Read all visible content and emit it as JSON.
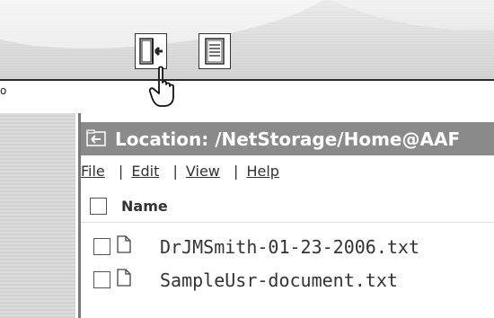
{
  "toolbar": {
    "buttons": [
      {
        "name": "exit-button",
        "icon": "exit-door-icon"
      },
      {
        "name": "document-button",
        "icon": "document-list-icon"
      }
    ],
    "cursor_icon": "hand-pointer-icon",
    "left_truncated_char": "o"
  },
  "location": {
    "icon": "folder-up-icon",
    "label": "Location: /NetStorage/Home@AAF"
  },
  "menu": {
    "items": [
      "File",
      "Edit",
      "View",
      "Help"
    ],
    "separator": "|"
  },
  "file_list": {
    "header": "Name",
    "rows": [
      {
        "name": "DrJMSmith-01-23-2006.txt",
        "icon": "text-file-icon"
      },
      {
        "name": "SampleUsr-document.txt",
        "icon": "text-file-icon"
      }
    ]
  },
  "colors": {
    "location_bar": "#8a8a8a",
    "text": "#333333",
    "panel": "#d8d8d8"
  }
}
